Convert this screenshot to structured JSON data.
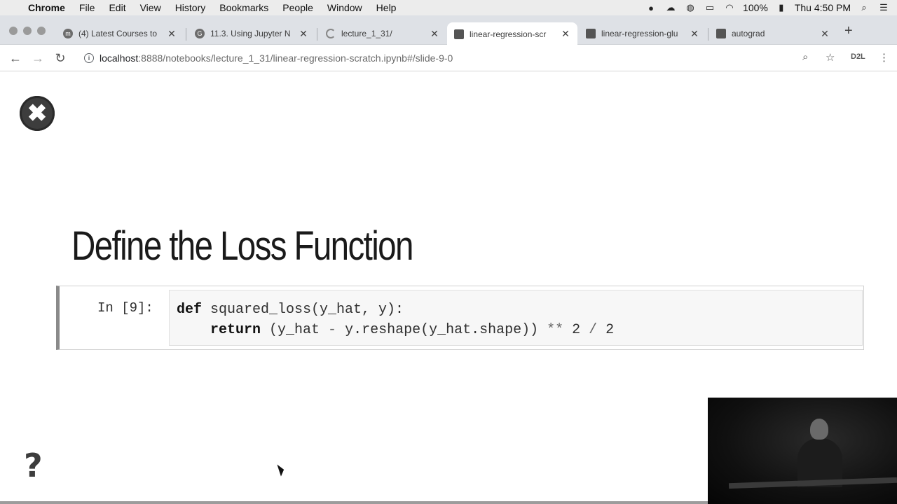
{
  "menubar": {
    "app": "Chrome",
    "items": [
      "File",
      "Edit",
      "View",
      "History",
      "Bookmarks",
      "People",
      "Window",
      "Help"
    ],
    "battery": "100%",
    "clock": "Thu 4:50 PM"
  },
  "tabs": [
    {
      "label": "(4) Latest Courses to",
      "favicon": "m"
    },
    {
      "label": "11.3. Using Jupyter N",
      "favicon": "G"
    },
    {
      "label": "lecture_1_31/",
      "favicon": "loading-icon"
    },
    {
      "label": "linear-regression-scr",
      "favicon": "book-icon"
    },
    {
      "label": "linear-regression-glu",
      "favicon": "book-icon"
    },
    {
      "label": "autograd",
      "favicon": "book-icon"
    }
  ],
  "toolbar": {
    "url_host": "localhost",
    "url_path": ":8888/notebooks/lecture_1_31/linear-regression-scratch.ipynb#/slide-9-0",
    "extension_label": "D2L"
  },
  "slide": {
    "title": "Define the Loss Function",
    "cell_prompt": "In [9]:",
    "code": {
      "line1_kw": "def",
      "line1_rest": " squared_loss(y_hat, y):",
      "line2_indent": "    ",
      "line2_kw": "return",
      "line2_rest": " (y_hat ",
      "line2_minus": "-",
      "line2_mid": " y.reshape(y_hat.shape)) ",
      "line2_pow": "**",
      "line2_num": " 2 ",
      "line2_div": "/",
      "line2_end": " 2"
    },
    "close_glyph": "✖",
    "help_glyph": "?"
  }
}
